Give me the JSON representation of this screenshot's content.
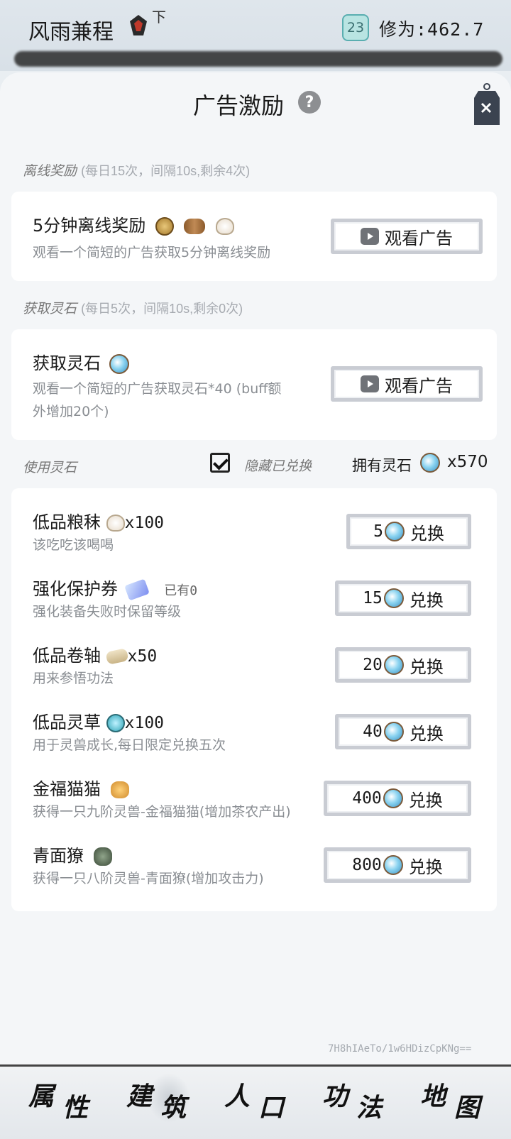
{
  "header": {
    "player_name": "风雨兼程",
    "rank_char": "下",
    "level": "23",
    "cultivation": "修为:462.7"
  },
  "panel": {
    "title": "广告激励"
  },
  "offline_section": {
    "label": "离线奖励",
    "sub": "(每日15次，间隔10s,剩余4次)",
    "card": {
      "title": "5分钟离线奖励",
      "desc": "观看一个简短的广告获取5分钟离线奖励",
      "button": "观看广告"
    }
  },
  "stone_section": {
    "label": "获取灵石",
    "sub": "(每日5次，间隔10s,剩余0次)",
    "card": {
      "title": "获取灵石",
      "desc_line1": "观看一个简短的广告获取灵石*40 (buff额",
      "desc_line2": "外增加20个)",
      "button": "观看广告"
    }
  },
  "use_section": {
    "label": "使用灵石",
    "hide_exchanged": "隐藏已兑换",
    "hide_checked": true,
    "owned_label": "拥有灵石",
    "owned_count": "x570"
  },
  "exchange_items": [
    {
      "name": "低品粮秣",
      "qty": "x100",
      "have": "",
      "desc": "该吃吃该喝喝",
      "cost": "5",
      "button": "兑换",
      "icon": "bun-icon"
    },
    {
      "name": "强化保护券",
      "qty": "",
      "have": "已有0",
      "desc": "强化装备失败时保留等级",
      "cost": "15",
      "button": "兑换",
      "icon": "ticket-icon"
    },
    {
      "name": "低品卷轴",
      "qty": "x50",
      "have": "",
      "desc": "用来参悟功法",
      "cost": "20",
      "button": "兑换",
      "icon": "scroll-icon"
    },
    {
      "name": "低品灵草",
      "qty": "x100",
      "have": "",
      "desc": "用于灵兽成长,每日限定兑换五次",
      "cost": "40",
      "button": "兑换",
      "icon": "herb-icon"
    },
    {
      "name": "金福猫猫",
      "qty": "",
      "have": "",
      "desc": "获得一只九阶灵兽-金福猫猫(增加茶农产出)",
      "cost": "400",
      "button": "兑换",
      "icon": "cat-icon"
    },
    {
      "name": "青面獠",
      "qty": "",
      "have": "",
      "desc": "获得一只八阶灵兽-青面獠(增加攻击力)",
      "cost": "800",
      "button": "兑换",
      "icon": "beast-icon"
    }
  ],
  "footer_hash": "7H8hIAeTo/1w6HDizCpKNg==",
  "nav": [
    {
      "c1": "属",
      "c2": "性"
    },
    {
      "c1": "建",
      "c2": "筑"
    },
    {
      "c1": "人",
      "c2": "口"
    },
    {
      "c1": "功",
      "c2": "法"
    },
    {
      "c1": "地",
      "c2": "图"
    }
  ]
}
